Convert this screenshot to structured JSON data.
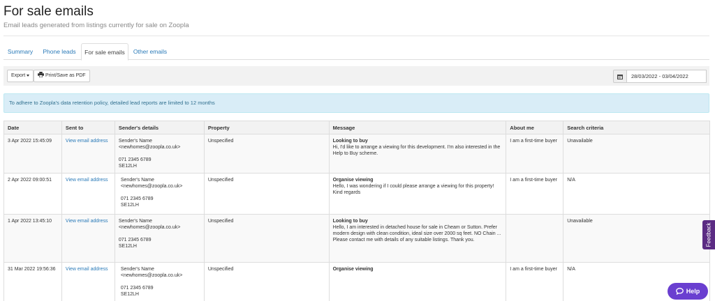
{
  "page": {
    "title": "For sale emails",
    "subtitle": "Email leads generated from listings currently for sale on Zoopla"
  },
  "tabs": [
    {
      "label": "Summary",
      "active": false
    },
    {
      "label": "Phone leads",
      "active": false
    },
    {
      "label": "For sale emails",
      "active": true
    },
    {
      "label": "Other emails",
      "active": false
    }
  ],
  "toolbar": {
    "export_label": "Export",
    "print_label": "Print/Save as PDF",
    "date_range": "28/03/2022 - 03/04/2022"
  },
  "alert": {
    "text": "To adhere to Zoopla's data retention policy, detailed lead reports are limited to 12 months"
  },
  "table": {
    "headers": [
      "Date",
      "Sent to",
      "Sender's details",
      "Property",
      "Message",
      "About me",
      "Search criteria"
    ],
    "rows": [
      {
        "date": "3 Apr 2022 15:45:09",
        "sent_to": "View email address",
        "sender_name": "Sender's Name",
        "sender_email": "<newhomes@zoopla.co.uk>",
        "sender_phone": "071 2345 6789",
        "sender_postcode": "SE12LH",
        "property": "Unspecified",
        "message_title": "Looking to buy",
        "message_body": "Hi, I'd like to arrange a viewing for this development. I'm also interested in the Help to Buy scheme.",
        "about_me": "I am a first-time buyer",
        "search_criteria": "Unavailable"
      },
      {
        "date": "2 Apr 2022 09:00:51",
        "sent_to": "View email address",
        "sender_name": "Sender's Name",
        "sender_email": "<newhomes@zoopla.co.uk>",
        "sender_phone": "071 2345 6789",
        "sender_postcode": "SE12LH",
        "property": "Unspecified",
        "message_title": "Organise viewing",
        "message_body": "Hello, I was wondering if I could please arrange a viewing for this property! Kind regards",
        "about_me": "I am a first-time buyer",
        "search_criteria": "N/A"
      },
      {
        "date": "1 Apr 2022 13:45:10",
        "sent_to": "View email address",
        "sender_name": "Sender's Name",
        "sender_email": "<newhomes@zoopla.co.uk>",
        "sender_phone": "071 2345 6789",
        "sender_postcode": "SE12LH",
        "property": "Unspecified",
        "message_title": "Looking to buy",
        "message_body": "Hello, I am interested in detached house for sale in Cheam or Sutton. Prefer modern design with clean condition, ideal size over 2000 sq feet. NO Chain ... Please contact me with details of any suitable listings. Thank you.",
        "about_me": "",
        "search_criteria": "Unavailable"
      },
      {
        "date": "31 Mar 2022 19:56:36",
        "sent_to": "View email address",
        "sender_name": "Sender's Name",
        "sender_email": "<newhomes@zoopla.co.uk>",
        "sender_phone": "071 2345 6789",
        "sender_postcode": "SE12LH",
        "property": "Unspecified",
        "message_title": "Organise viewing",
        "message_body": "",
        "about_me": "I am a first-time buyer",
        "search_criteria": "N/A"
      }
    ]
  },
  "widgets": {
    "feedback_label": "Feedback",
    "help_label": "Help"
  },
  "colors": {
    "link": "#2a7ab8",
    "alert_bg": "#d9edf7",
    "alert_text": "#31708f",
    "feedback_bg": "#5b2b83",
    "help_bg": "#6a3fd0"
  }
}
